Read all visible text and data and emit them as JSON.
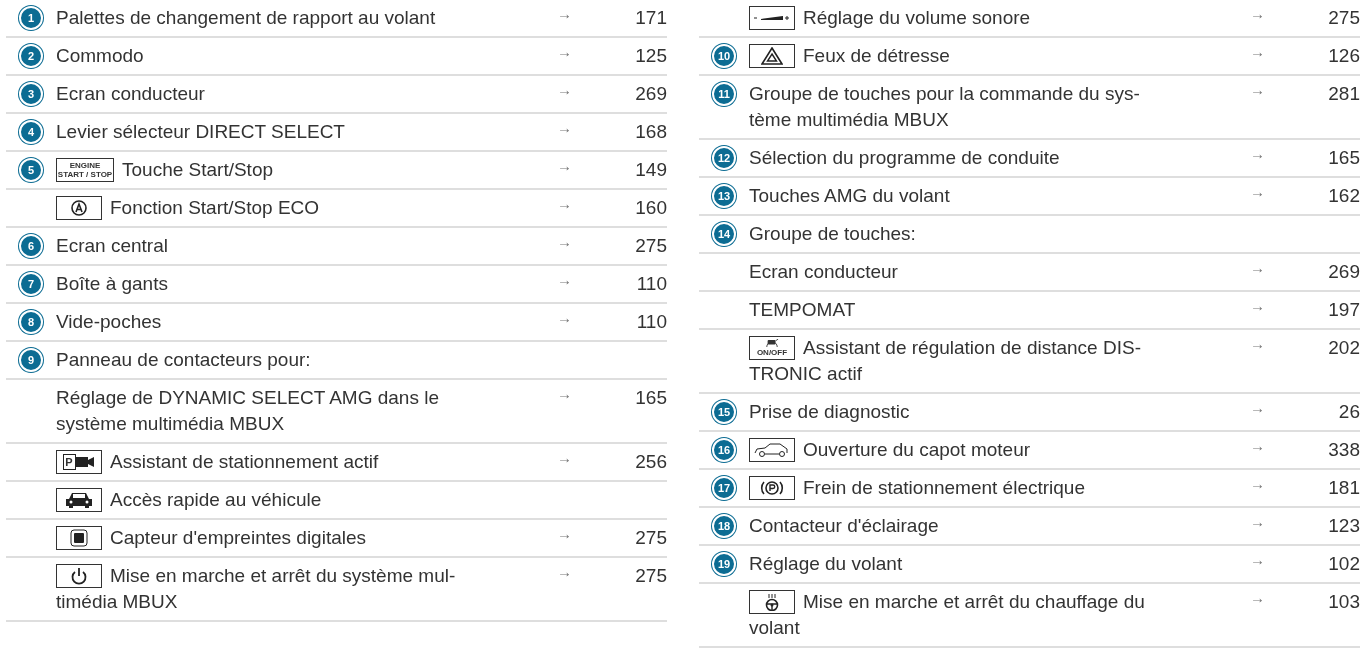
{
  "columns": [
    {
      "rows": [
        {
          "number": "1",
          "text": "Palettes de changement de rapport au volant",
          "arrow": "→",
          "page": "171"
        },
        {
          "number": "2",
          "text": "Commodo",
          "arrow": "→",
          "page": "125"
        },
        {
          "number": "3",
          "text": "Ecran conducteur",
          "arrow": "→",
          "page": "269"
        },
        {
          "number": "4",
          "text": "Levier sélecteur DIRECT SELECT",
          "arrow": "→",
          "page": "168"
        },
        {
          "number": "5",
          "kind": "engine",
          "icon_text": [
            "ENGINE",
            "START / STOP"
          ],
          "text": "Touche Start/Stop",
          "arrow": "→",
          "page": "149"
        },
        {
          "kind": "eco",
          "text": "Fonction Start/Stop ECO",
          "arrow": "→",
          "page": "160"
        },
        {
          "number": "6",
          "text": "Ecran central",
          "arrow": "→",
          "page": "275"
        },
        {
          "number": "7",
          "text": "Boîte à gants",
          "arrow": "→",
          "page": "110"
        },
        {
          "number": "8",
          "text": "Vide-poches",
          "arrow": "→",
          "page": "110"
        },
        {
          "number": "9",
          "text": "Panneau de contacteurs pour:"
        },
        {
          "text": "Réglage de DYNAMIC SELECT AMG dans le\nsystème multimédia MBUX",
          "arrow": "→",
          "page": "165"
        },
        {
          "kind": "parking-camera",
          "icon_text": [
            "P"
          ],
          "text": "Assistant de stationnement actif",
          "arrow": "→",
          "page": "256"
        },
        {
          "kind": "car-front",
          "text": "Accès rapide au véhicule"
        },
        {
          "kind": "fingerprint",
          "text": "Capteur d'empreintes digitales",
          "arrow": "→",
          "page": "275"
        },
        {
          "kind": "power",
          "text": "Mise en marche et arrêt du système mul-\ntimédia MBUX",
          "arrow": "→",
          "page": "275"
        }
      ]
    },
    {
      "rows": [
        {
          "kind": "volume",
          "text": "Réglage du volume sonore",
          "arrow": "→",
          "page": "275"
        },
        {
          "number": "10",
          "kind": "hazard",
          "text": "Feux de détresse",
          "arrow": "→",
          "page": "126"
        },
        {
          "number": "11",
          "text": "Groupe de touches pour la commande du sys-\ntème multimédia MBUX",
          "arrow": "→",
          "page": "281"
        },
        {
          "number": "12",
          "text": "Sélection du programme de conduite",
          "arrow": "→",
          "page": "165"
        },
        {
          "number": "13",
          "text": "Touches AMG du volant",
          "arrow": "→",
          "page": "162"
        },
        {
          "number": "14",
          "text": "Groupe de touches:"
        },
        {
          "text": "Ecran conducteur",
          "arrow": "→",
          "page": "269"
        },
        {
          "text": "TEMPOMAT",
          "arrow": "→",
          "page": "197"
        },
        {
          "kind": "distronic",
          "icon_text": [
            "ON/OFF"
          ],
          "text": "Assistant de régulation de distance DIS-\nTRONIC actif",
          "arrow": "→",
          "page": "202"
        },
        {
          "number": "15",
          "text": "Prise de diagnostic",
          "arrow": "→",
          "page": "26"
        },
        {
          "number": "16",
          "kind": "hood",
          "text": "Ouverture du capot moteur",
          "arrow": "→",
          "page": "338"
        },
        {
          "number": "17",
          "kind": "parking-brake",
          "text": "Frein de stationnement électrique",
          "arrow": "→",
          "page": "181"
        },
        {
          "number": "18",
          "text": "Contacteur d'éclairage",
          "arrow": "→",
          "page": "123"
        },
        {
          "number": "19",
          "text": "Réglage du volant",
          "arrow": "→",
          "page": "102"
        },
        {
          "kind": "heated-wheel",
          "text": "Mise en marche et arrêt du chauffage du\nvolant",
          "arrow": "→",
          "page": "103"
        }
      ]
    }
  ]
}
